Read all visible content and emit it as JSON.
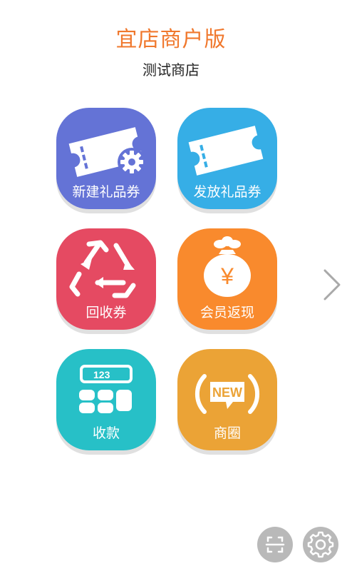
{
  "header": {
    "app_title": "宜店商户版",
    "store_name": "测试商店"
  },
  "tiles": [
    {
      "label": "新建礼品券",
      "icon": "ticket-gear-icon",
      "color": "#6473d6"
    },
    {
      "label": "发放礼品券",
      "icon": "ticket-icon",
      "color": "#36aee6"
    },
    {
      "label": "回收券",
      "icon": "recycle-icon",
      "color": "#e54a62"
    },
    {
      "label": "会员返现",
      "icon": "money-bag-icon",
      "color": "#f98a2d"
    },
    {
      "label": "收款",
      "icon": "calculator-icon",
      "color": "#27c0c7"
    },
    {
      "label": "商圈",
      "icon": "new-badge-icon",
      "color": "#eba336"
    }
  ],
  "icon_text": {
    "yen": "¥",
    "calculator_display": "123",
    "new_badge": "NEW"
  },
  "navigation": {
    "next_icon": "chevron-right-icon"
  },
  "bottom_actions": [
    {
      "icon": "scan-icon"
    },
    {
      "icon": "settings-gear-icon"
    }
  ]
}
